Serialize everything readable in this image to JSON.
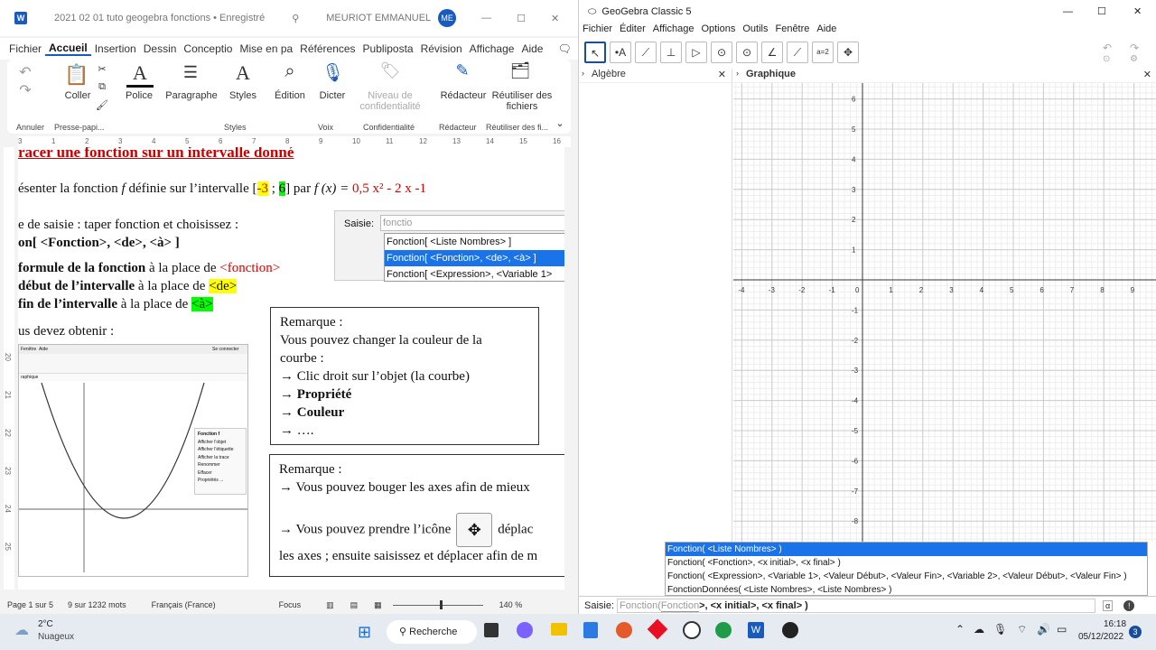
{
  "word": {
    "title": "2021 02 01 tuto geogebra fonctions • Enregistré",
    "user": "MEURIOT EMMANUEL",
    "user_initials": "ME",
    "tabs": [
      "Fichier",
      "Accueil",
      "Insertion",
      "Dessin",
      "Conceptio",
      "Mise en pa",
      "Références",
      "Publiposta",
      "Révision",
      "Affichage",
      "Aide"
    ],
    "active_tab": "Accueil",
    "ribbon": {
      "undo_group": "Annuler",
      "paste": "Coller",
      "clipboard_group": "Presse-papi...",
      "font": "Police",
      "paragraph": "Paragraphe",
      "styles": "Styles",
      "styles_group": "Styles",
      "edit": "Édition",
      "dictate": "Dicter",
      "voice_group": "Voix",
      "sensitivity": "Niveau de confidentialité",
      "conf_group": "Confidentialité",
      "editor": "Rédacteur",
      "editor_group": "Rédacteur",
      "reuse": "Réutiliser des fichiers",
      "reuse_group": "Réutiliser des fi..."
    },
    "ruler": [
      "3",
      "1",
      "2",
      "3",
      "4",
      "5",
      "6",
      "7",
      "8",
      "9",
      "10",
      "11",
      "12",
      "13",
      "14",
      "15",
      "16"
    ],
    "vruler": [
      "20",
      "21",
      "22",
      "23",
      "24",
      "25"
    ],
    "doc": {
      "heading": "racer une fonction sur un intervalle donné",
      "line1a": "ésenter la fonction ",
      "line1b": "f",
      "line1c": " définie sur l’intervalle [",
      "line1d": "-3",
      "line1e": " ; ",
      "line1f": "6",
      "line1g": "] par ",
      "line1h": "f (x) = ",
      "line1i": "0,5 x² - 2 x -1",
      "line2": "e de saisie : taper fonction et choisissez :",
      "line3": "on[ <Fonction>, <de>, <à> ]",
      "line4a": "formule de la fonction",
      "line4b": " à la place de ",
      "line4c": "<fonction>",
      "line5a": "début de l’intervalle",
      "line5b": " à la place de ",
      "line5c": "<de>",
      "line6a": "fin de l’intervalle",
      "line6b": " à la place de ",
      "line6c": "<à>",
      "line7": "us devez obtenir :",
      "popup_label": "Saisie:",
      "popup_input": "fonctio",
      "popup_items": [
        "Fonction[ <Liste Nombres> ]",
        "Fonction[ <Fonction>, <de>, <à> ]",
        "Fonction[ <Expression>, <Variable 1>"
      ],
      "box1": [
        "Remarque :",
        "Vous pouvez changer la couleur de la",
        "courbe :",
        "→ Clic droit sur l’objet (la courbe)",
        "→ Propriété",
        "→ Couleur",
        "→ …."
      ],
      "box2": [
        "Remarque :",
        "→ Vous pouvez bouger les axes afin de mieux",
        "→ Vous pouvez prendre l’icône",
        "déplac",
        "les axes ; ensuite saisissez et déplacer afin de m"
      ],
      "thumb": {
        "menu1": "Fenêtre",
        "menu2": "Aide",
        "connect": "Se connecter",
        "panel": "raphique",
        "ctx_title": "Fonction f",
        "ctx_items": [
          "Afficher l'objet",
          "Afficher l'étiquette",
          "Afficher la trace",
          "Renommer",
          "Effacer",
          "Propriétés ..."
        ]
      }
    },
    "status": {
      "page": "Page 1 sur 5",
      "words": "9 sur 1232 mots",
      "lang": "Français (France)",
      "focus": "Focus",
      "zoom": "140 %"
    }
  },
  "ggb": {
    "title": "GeoGebra Classic 5",
    "menu": [
      "Fichier",
      "Éditer",
      "Affichage",
      "Options",
      "Outils",
      "Fenêtre",
      "Aide"
    ],
    "tools": [
      "↖",
      "•A",
      "⟋",
      "⊥",
      "▷",
      "⊙",
      "⊙",
      "∠",
      "⟋",
      "a=2",
      "✥"
    ],
    "algebra": "Algèbre",
    "graphics": "Graphique",
    "xticks": [
      "-4",
      "-3",
      "-2",
      "-1",
      "0",
      "1",
      "2",
      "3",
      "4",
      "5",
      "6",
      "7",
      "8",
      "9"
    ],
    "yticks": [
      "6",
      "5",
      "4",
      "3",
      "2",
      "1",
      "-1",
      "-2",
      "-3",
      "-4",
      "-5",
      "-6",
      "-7",
      "-8"
    ],
    "suggestions": [
      "Fonction( <Liste Nombres> )",
      "Fonction( <Fonction>, <x initial>, <x final> )",
      "Fonction( <Expression>, <Variable 1>, <Valeur Début>, <Valeur Fin>, <Variable 2>, <Valeur Début>, <Valeur Fin> )",
      "FonctionDonnées( <Liste Nombres>, <Liste Nombres> )"
    ],
    "input_label": "Saisie:",
    "input_text": "Fonction(",
    "input_hint": "Fonction",
    "input_rest": ">, <x initial>, <x final> )"
  },
  "taskbar": {
    "weather_temp": "2°C",
    "weather_text": "Nuageux",
    "search": "Recherche",
    "time": "16:18",
    "date": "05/12/2022",
    "badge": "3"
  }
}
